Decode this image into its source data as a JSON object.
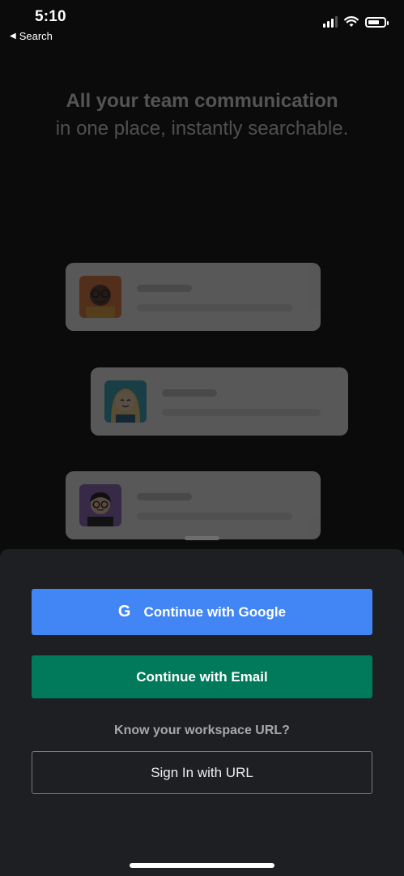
{
  "status_bar": {
    "time": "5:10",
    "back_label": "Search"
  },
  "headline": {
    "line1": "All your team communication",
    "line2": "in one place, instantly searchable."
  },
  "actions": {
    "google_label": "Continue with Google",
    "google_icon": "G",
    "email_label": "Continue with Email",
    "workspace_prompt": "Know your workspace URL?",
    "url_label": "Sign In with URL"
  },
  "colors": {
    "google": "#4285f4",
    "email": "#007a5a",
    "sheet": "#1d1f23"
  }
}
